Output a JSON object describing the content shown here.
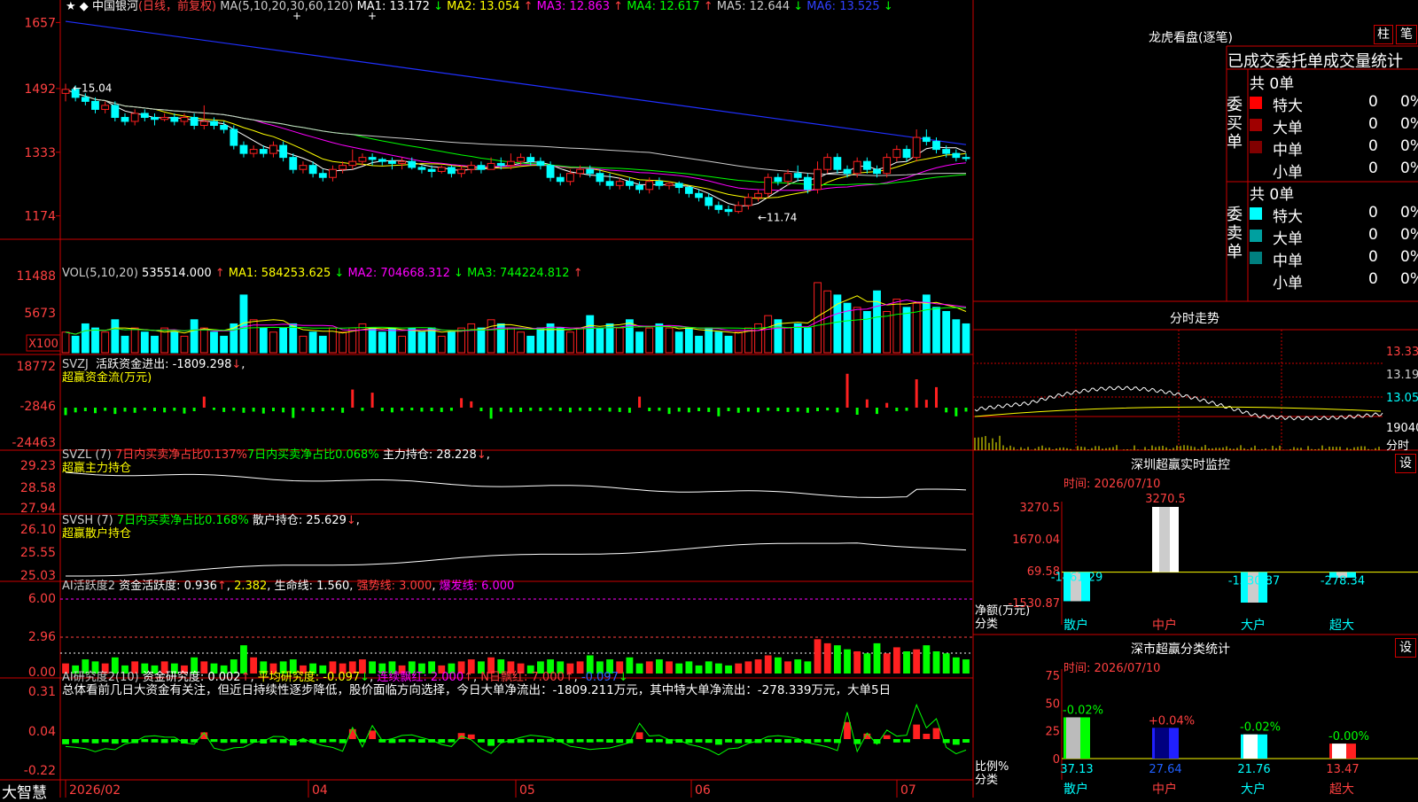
{
  "app": {
    "brand": "大智慧"
  },
  "stock": {
    "name": "中国银河",
    "period_label": "(日线，前复权)",
    "ma_header": "MA(5,10,20,30,60,120)",
    "ma_values": [
      {
        "label": "MA1: 13.172",
        "arrow": "↓",
        "color": "#ffffff"
      },
      {
        "label": "MA2: 13.054",
        "arrow": "↑",
        "color": "#ffff00"
      },
      {
        "label": "MA3: 12.863",
        "arrow": "↑",
        "color": "#ff00ff"
      },
      {
        "label": "MA4: 12.617",
        "arrow": "↑",
        "color": "#00ff00"
      },
      {
        "label": "MA5: 12.644",
        "arrow": "↓",
        "color": "#cccccc"
      },
      {
        "label": "MA6: 13.525",
        "arrow": "↓",
        "color": "#3040ff"
      }
    ],
    "hi_label": "←15.04",
    "lo_label": "←11.74",
    "price_ticks": [
      "1657",
      "1492",
      "1333",
      "1174"
    ],
    "date_labels": [
      "2026/02",
      "04",
      "05",
      "06",
      "07"
    ]
  },
  "vol_panel": {
    "header": "VOL(5,10,20)",
    "values": [
      {
        "label": "535514.000",
        "arrow": "↑",
        "color": "#ffffff"
      },
      {
        "label": "MA1: 584253.625",
        "arrow": "↓",
        "color": "#ffff00"
      },
      {
        "label": "MA2: 704668.312",
        "arrow": "↓",
        "color": "#ff00ff"
      },
      {
        "label": "MA3: 744224.812",
        "arrow": "↑",
        "color": "#00ff00"
      }
    ],
    "ticks": [
      "11488",
      "5673"
    ],
    "unit_label": "X100"
  },
  "svzj_panel": {
    "header": "SVZJ",
    "line1": "活跃资金进出: -1809.298",
    "line1_arrow": "↓",
    "line2": "超赢资金流(万元)",
    "ticks": [
      "18772",
      "-2846",
      "-24463"
    ]
  },
  "svzl_panel": {
    "header": "SVZL (7)",
    "p1": "7日内买卖净占比0.137%",
    "p2": "7日内买卖净占比0.068%",
    "p3": "主力持仓: 28.228",
    "p3_arrow": "↓",
    "line2": "超赢主力持仓",
    "ticks": [
      "29.23",
      "28.58",
      "27.94"
    ]
  },
  "svsh_panel": {
    "header": "SVSH (7)",
    "p1": "7日内买卖净占比0.168%",
    "p2": "散户持仓: 25.629",
    "p2_arrow": "↓",
    "line2": "超赢散户持仓",
    "ticks": [
      "26.10",
      "25.55",
      "25.03"
    ]
  },
  "ai_active_panel": {
    "header": "AI活跃度2",
    "p1": "资金活跃度: 0.936",
    "p1_arrow": "↑",
    "p2": "2.382",
    "p3": "生命线: 1.560",
    "p4": "强势线: 3.000",
    "p5": "爆发线: 6.000",
    "ticks": [
      "6.00",
      "2.96",
      "0.00"
    ]
  },
  "ai_research_panel": {
    "header": "AI研究度2(10)",
    "p1": "资金研究度: 0.002",
    "p1_arrow": "↑",
    "p2": "平均研究度: -0.097",
    "p2_arrow": "↓",
    "p3": "连续飘红: 2.000",
    "p3_arrow": "↑",
    "p4": "N日飘红: 7.000",
    "p4_arrow": "↑",
    "p5": "-0.097",
    "p5_arrow": "↓",
    "comment": "总体看前几日大资金有关注，但近日持续性逐步降低，股价面临方向选择，今日大单净流出：-1809.211万元，其中特大单净流出：-278.339万元，大单5日",
    "ticks": [
      "0.31",
      "0.04",
      "-0.22"
    ]
  },
  "dragon_tiger": {
    "title": "龙虎看盘(逐笔)",
    "btn_bar": "柱",
    "btn_pen": "笔",
    "tabs_text": "已成交委托单成交量统计",
    "buy_label": "委买单",
    "sell_label": "委卖单",
    "buy_total": "共 0单",
    "sell_total": "共 0单",
    "rows": [
      {
        "name": "特大",
        "count": "0",
        "pct": "0%"
      },
      {
        "name": "大单",
        "count": "0",
        "pct": "0%"
      },
      {
        "name": "中单",
        "count": "0",
        "pct": "0%"
      },
      {
        "name": "小单",
        "count": "0",
        "pct": "0%"
      }
    ],
    "buy_colors": [
      "#ff0000",
      "#a00000",
      "#800000"
    ],
    "sell_colors": [
      "#00ffff",
      "#00a0a0",
      "#008080"
    ]
  },
  "intraday": {
    "title": "分时走势",
    "price_ticks": [
      "13.33",
      "13.19",
      "13.05"
    ],
    "vol_tick": "19040",
    "footer": "分时"
  },
  "sz_monitor": {
    "title": "深圳超赢实时监控",
    "btn": "设",
    "time_label": "时间: 2026/07/10",
    "ticks": [
      "3270.5",
      "1670.04",
      "69.58",
      "-1530.87"
    ],
    "y_label": "净额(万元)",
    "x_label": "分类",
    "categories": [
      "散户",
      "中户",
      "大户",
      "超大"
    ],
    "values": [
      -1461.29,
      3270.5,
      -1530.87,
      -278.34
    ],
    "value_labels": [
      "-1461.29",
      "3270.5",
      "-1530.87",
      "-278.34"
    ]
  },
  "sz_class": {
    "title": "深市超赢分类统计",
    "btn": "设",
    "time_label": "时间: 2026/07/10",
    "ticks": [
      "75",
      "50",
      "25",
      "0"
    ],
    "y_label": "比例%",
    "x_label": "分类",
    "categories": [
      "散户",
      "中户",
      "大户",
      "超大"
    ],
    "values": [
      37.13,
      27.64,
      21.76,
      13.47
    ],
    "changes": [
      "-0.02%",
      "+0.04%",
      "-0.02%",
      "-0.00%"
    ]
  },
  "chart_data": {
    "type": "candlestick",
    "title": "中国银河",
    "price_range": [
      11.2,
      16.8
    ],
    "high": 15.04,
    "low": 11.74,
    "ma_last": {
      "MA5": 13.172,
      "MA10": 13.054,
      "MA20": 12.863,
      "MA30": 12.617,
      "MA60": 12.644,
      "MA120": 13.525
    },
    "candles": [
      [
        14.8,
        14.9,
        15.04,
        14.6
      ],
      [
        14.9,
        14.7,
        15.0,
        14.6
      ],
      [
        14.7,
        14.6,
        14.8,
        14.5
      ],
      [
        14.6,
        14.4,
        14.7,
        14.3
      ],
      [
        14.4,
        14.5,
        14.6,
        14.3
      ],
      [
        14.5,
        14.2,
        14.6,
        14.1
      ],
      [
        14.2,
        14.1,
        14.3,
        14.0
      ],
      [
        14.1,
        14.3,
        14.4,
        14.0
      ],
      [
        14.3,
        14.2,
        14.4,
        14.1
      ],
      [
        14.2,
        14.15,
        14.3,
        14.0
      ],
      [
        14.15,
        14.2,
        14.3,
        14.1
      ],
      [
        14.2,
        14.1,
        14.3,
        14.0
      ],
      [
        14.1,
        14.2,
        14.3,
        14.0
      ],
      [
        14.2,
        14.0,
        14.3,
        13.9
      ],
      [
        14.0,
        14.1,
        14.5,
        13.9
      ],
      [
        14.1,
        14.0,
        14.2,
        13.9
      ],
      [
        14.0,
        13.9,
        14.1,
        13.8
      ],
      [
        13.9,
        13.5,
        14.0,
        13.4
      ],
      [
        13.5,
        13.3,
        13.6,
        13.2
      ],
      [
        13.3,
        13.4,
        13.5,
        13.2
      ],
      [
        13.4,
        13.3,
        13.5,
        13.2
      ],
      [
        13.3,
        13.5,
        13.6,
        13.2
      ],
      [
        13.5,
        13.2,
        13.6,
        13.1
      ],
      [
        13.2,
        12.9,
        13.3,
        12.8
      ],
      [
        12.9,
        13.0,
        13.1,
        12.8
      ],
      [
        13.0,
        12.8,
        13.1,
        12.7
      ],
      [
        12.8,
        12.7,
        12.9,
        12.6
      ],
      [
        12.7,
        12.9,
        13.0,
        12.6
      ],
      [
        12.9,
        13.0,
        13.1,
        12.8
      ],
      [
        13.0,
        13.1,
        13.4,
        12.9
      ],
      [
        13.1,
        13.2,
        13.3,
        13.0
      ],
      [
        13.2,
        13.15,
        13.3,
        13.0
      ],
      [
        13.15,
        13.1,
        13.2,
        13.0
      ],
      [
        13.1,
        13.05,
        13.2,
        12.9
      ],
      [
        13.05,
        13.1,
        13.2,
        12.9
      ],
      [
        13.1,
        12.95,
        13.2,
        12.9
      ],
      [
        12.95,
        12.9,
        13.0,
        12.8
      ],
      [
        12.9,
        12.85,
        13.0,
        12.7
      ],
      [
        12.85,
        12.95,
        13.0,
        12.8
      ],
      [
        12.95,
        12.8,
        13.0,
        12.7
      ],
      [
        12.8,
        12.9,
        13.0,
        12.7
      ],
      [
        12.9,
        13.0,
        13.1,
        12.8
      ],
      [
        13.0,
        12.9,
        13.1,
        12.8
      ],
      [
        12.9,
        13.05,
        13.2,
        12.9
      ],
      [
        13.05,
        13.0,
        13.2,
        12.9
      ],
      [
        13.0,
        13.1,
        13.3,
        12.9
      ],
      [
        13.1,
        13.2,
        13.3,
        13.0
      ],
      [
        13.2,
        13.1,
        13.3,
        13.0
      ],
      [
        13.1,
        13.0,
        13.2,
        12.9
      ],
      [
        13.0,
        12.7,
        13.1,
        12.6
      ],
      [
        12.7,
        12.6,
        12.8,
        12.5
      ],
      [
        12.6,
        12.8,
        12.9,
        12.5
      ],
      [
        12.8,
        12.9,
        13.0,
        12.7
      ],
      [
        12.9,
        12.8,
        13.0,
        12.7
      ],
      [
        12.8,
        12.6,
        12.9,
        12.5
      ],
      [
        12.6,
        12.5,
        12.8,
        12.4
      ],
      [
        12.5,
        12.6,
        12.7,
        12.4
      ],
      [
        12.6,
        12.5,
        12.7,
        12.4
      ],
      [
        12.5,
        12.4,
        12.6,
        12.3
      ],
      [
        12.4,
        12.6,
        12.7,
        12.3
      ],
      [
        12.6,
        12.5,
        12.7,
        12.4
      ],
      [
        12.5,
        12.55,
        12.6,
        12.4
      ],
      [
        12.55,
        12.45,
        12.6,
        12.3
      ],
      [
        12.45,
        12.3,
        12.5,
        12.2
      ],
      [
        12.3,
        12.2,
        12.4,
        12.1
      ],
      [
        12.2,
        12.0,
        12.3,
        11.9
      ],
      [
        12.0,
        11.9,
        12.1,
        11.8
      ],
      [
        11.9,
        11.85,
        12.0,
        11.74
      ],
      [
        11.85,
        12.0,
        12.1,
        11.8
      ],
      [
        12.0,
        12.2,
        12.3,
        11.9
      ],
      [
        12.2,
        12.3,
        12.4,
        12.1
      ],
      [
        12.3,
        12.7,
        12.8,
        12.2
      ],
      [
        12.7,
        12.6,
        12.8,
        12.5
      ],
      [
        12.6,
        12.8,
        12.9,
        12.5
      ],
      [
        12.8,
        12.7,
        13.0,
        12.6
      ],
      [
        12.7,
        12.4,
        12.8,
        12.3
      ],
      [
        12.4,
        12.9,
        13.1,
        12.3
      ],
      [
        12.9,
        13.2,
        13.3,
        12.8
      ],
      [
        13.2,
        12.9,
        13.3,
        12.8
      ],
      [
        12.9,
        12.8,
        13.0,
        12.7
      ],
      [
        12.8,
        13.1,
        13.2,
        12.7
      ],
      [
        13.1,
        12.9,
        13.2,
        12.8
      ],
      [
        12.9,
        12.8,
        13.0,
        12.7
      ],
      [
        12.8,
        13.2,
        13.3,
        12.7
      ],
      [
        13.2,
        13.4,
        13.5,
        13.1
      ],
      [
        13.4,
        13.2,
        13.5,
        13.1
      ],
      [
        13.2,
        13.7,
        13.9,
        13.1
      ],
      [
        13.7,
        13.6,
        13.9,
        13.5
      ],
      [
        13.6,
        13.4,
        13.7,
        13.3
      ],
      [
        13.4,
        13.3,
        13.5,
        13.2
      ],
      [
        13.3,
        13.2,
        13.4,
        13.1
      ],
      [
        13.2,
        13.172,
        13.3,
        13.1
      ]
    ],
    "svzj": [
      -1900,
      -1200,
      -900,
      -1400,
      -800,
      -1600,
      -1000,
      -1300,
      -700,
      -900,
      -1200,
      -800,
      -1500,
      -900,
      2800,
      -600,
      -1100,
      -800,
      -1300,
      -1000,
      -1500,
      -900,
      -1200,
      -2600,
      -800,
      -1100,
      -900,
      -700,
      -1300,
      4600,
      -800,
      3800,
      -900,
      -1200,
      -800,
      -700,
      -1000,
      -900,
      -1100,
      -800,
      2400,
      1600,
      -900,
      -2800,
      -1000,
      -1200,
      -1100,
      -800,
      -900,
      -700,
      -900,
      -1200,
      -800,
      -900,
      -700,
      -1000,
      -1100,
      -1300,
      2800,
      -900,
      -800,
      -1600,
      -1000,
      -1200,
      -900,
      -1100,
      -2200,
      -900,
      -1300,
      -1000,
      -1200,
      -800,
      -900,
      -1100,
      -1000,
      -1300,
      -900,
      -700,
      -1200,
      8600,
      -1800,
      2100,
      -1600,
      1200,
      -900,
      -800,
      7200,
      2000,
      5200,
      -1200,
      -2200,
      -1000
    ]
  }
}
